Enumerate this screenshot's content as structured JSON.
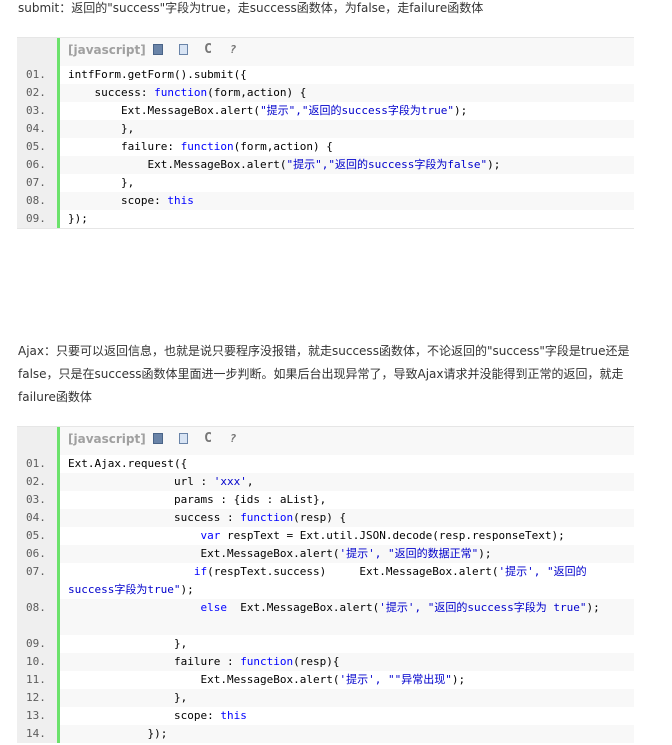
{
  "paragraph1": "submit：返回的\"success\"字段为true，走success函数体，为false，走failure函数体",
  "paragraph2": "Ajax：只要可以返回信息，也就是说只要程序没报错，就走success函数体，不论返回的\"success\"字段是true还是false，只是在success函数体里面进一步判断。如果后台出现异常了，导致Ajax请求并没能得到正常的返回，就走failure函数体",
  "toolbar": {
    "language_label": "[javascript]",
    "view_source_icon": "view-source-icon",
    "copy_icon": "copy-icon",
    "print_label": "C",
    "about_label": "?"
  },
  "block1": {
    "lines": [
      {
        "num": "01.",
        "parts": [
          [
            "t",
            "intfForm.getForm().submit({"
          ]
        ]
      },
      {
        "num": "02.",
        "parts": [
          [
            "t",
            "    success: "
          ],
          [
            "k",
            "function"
          ],
          [
            "t",
            "(form,action) {"
          ]
        ]
      },
      {
        "num": "03.",
        "parts": [
          [
            "t",
            "        Ext.MessageBox.alert("
          ],
          [
            "s",
            "\"提示\",\"返回的success字段为true\""
          ],
          [
            "t",
            ");"
          ]
        ]
      },
      {
        "num": "04.",
        "parts": [
          [
            "t",
            "        },"
          ]
        ]
      },
      {
        "num": "05.",
        "parts": [
          [
            "t",
            "        failure: "
          ],
          [
            "k",
            "function"
          ],
          [
            "t",
            "(form,action) {"
          ]
        ]
      },
      {
        "num": "06.",
        "parts": [
          [
            "t",
            "            Ext.MessageBox.alert("
          ],
          [
            "s",
            "\"提示\",\"返回的success字段为false\""
          ],
          [
            "t",
            ");"
          ]
        ]
      },
      {
        "num": "07.",
        "parts": [
          [
            "t",
            "        },"
          ]
        ]
      },
      {
        "num": "08.",
        "parts": [
          [
            "t",
            "        scope: "
          ],
          [
            "k",
            "this"
          ]
        ]
      },
      {
        "num": "09.",
        "parts": [
          [
            "t",
            "});"
          ]
        ]
      }
    ]
  },
  "block2": {
    "lines": [
      {
        "num": "01.",
        "parts": [
          [
            "t",
            "Ext.Ajax.request({"
          ]
        ]
      },
      {
        "num": "02.",
        "parts": [
          [
            "t",
            "                url : "
          ],
          [
            "s",
            "'xxx'"
          ],
          [
            "t",
            ","
          ]
        ]
      },
      {
        "num": "03.",
        "parts": [
          [
            "t",
            "                params : {ids : aList},"
          ]
        ]
      },
      {
        "num": "04.",
        "parts": [
          [
            "t",
            "                success : "
          ],
          [
            "k",
            "function"
          ],
          [
            "t",
            "(resp) {"
          ]
        ]
      },
      {
        "num": "05.",
        "parts": [
          [
            "t",
            "                    "
          ],
          [
            "k",
            "var"
          ],
          [
            "t",
            " respText = Ext.util.JSON.decode(resp.responseText);"
          ]
        ]
      },
      {
        "num": "06.",
        "parts": [
          [
            "t",
            "                    Ext.MessageBox.alert("
          ],
          [
            "s",
            "'提示', \"返回的数据正常\""
          ],
          [
            "t",
            ");"
          ]
        ]
      },
      {
        "num": "07.",
        "tall": true,
        "parts": [
          [
            "t",
            "                   "
          ],
          [
            "k",
            "if"
          ],
          [
            "t",
            "(respText.success)     Ext.MessageBox.alert("
          ],
          [
            "s",
            "'提示', \"返回的 success字段为true\""
          ],
          [
            "t",
            ");"
          ]
        ]
      },
      {
        "num": "08.",
        "tall": true,
        "parts": [
          [
            "t",
            "                    "
          ],
          [
            "k",
            "else"
          ],
          [
            "t",
            "  Ext.MessageBox.alert("
          ],
          [
            "s",
            "'提示', \"返回的success字段为 true\""
          ],
          [
            "t",
            ");"
          ]
        ]
      },
      {
        "num": "09.",
        "parts": [
          [
            "t",
            "                },"
          ]
        ]
      },
      {
        "num": "10.",
        "parts": [
          [
            "t",
            "                failure : "
          ],
          [
            "k",
            "function"
          ],
          [
            "t",
            "(resp){"
          ]
        ]
      },
      {
        "num": "11.",
        "parts": [
          [
            "t",
            "                    Ext.MessageBox.alert("
          ],
          [
            "s",
            "'提示', \"\"异常出现\""
          ],
          [
            "t",
            ");"
          ]
        ]
      },
      {
        "num": "12.",
        "parts": [
          [
            "t",
            "                },"
          ]
        ]
      },
      {
        "num": "13.",
        "parts": [
          [
            "t",
            "                scope: "
          ],
          [
            "k",
            "this"
          ]
        ]
      },
      {
        "num": "14.",
        "parts": [
          [
            "t",
            "            });"
          ]
        ]
      }
    ]
  }
}
